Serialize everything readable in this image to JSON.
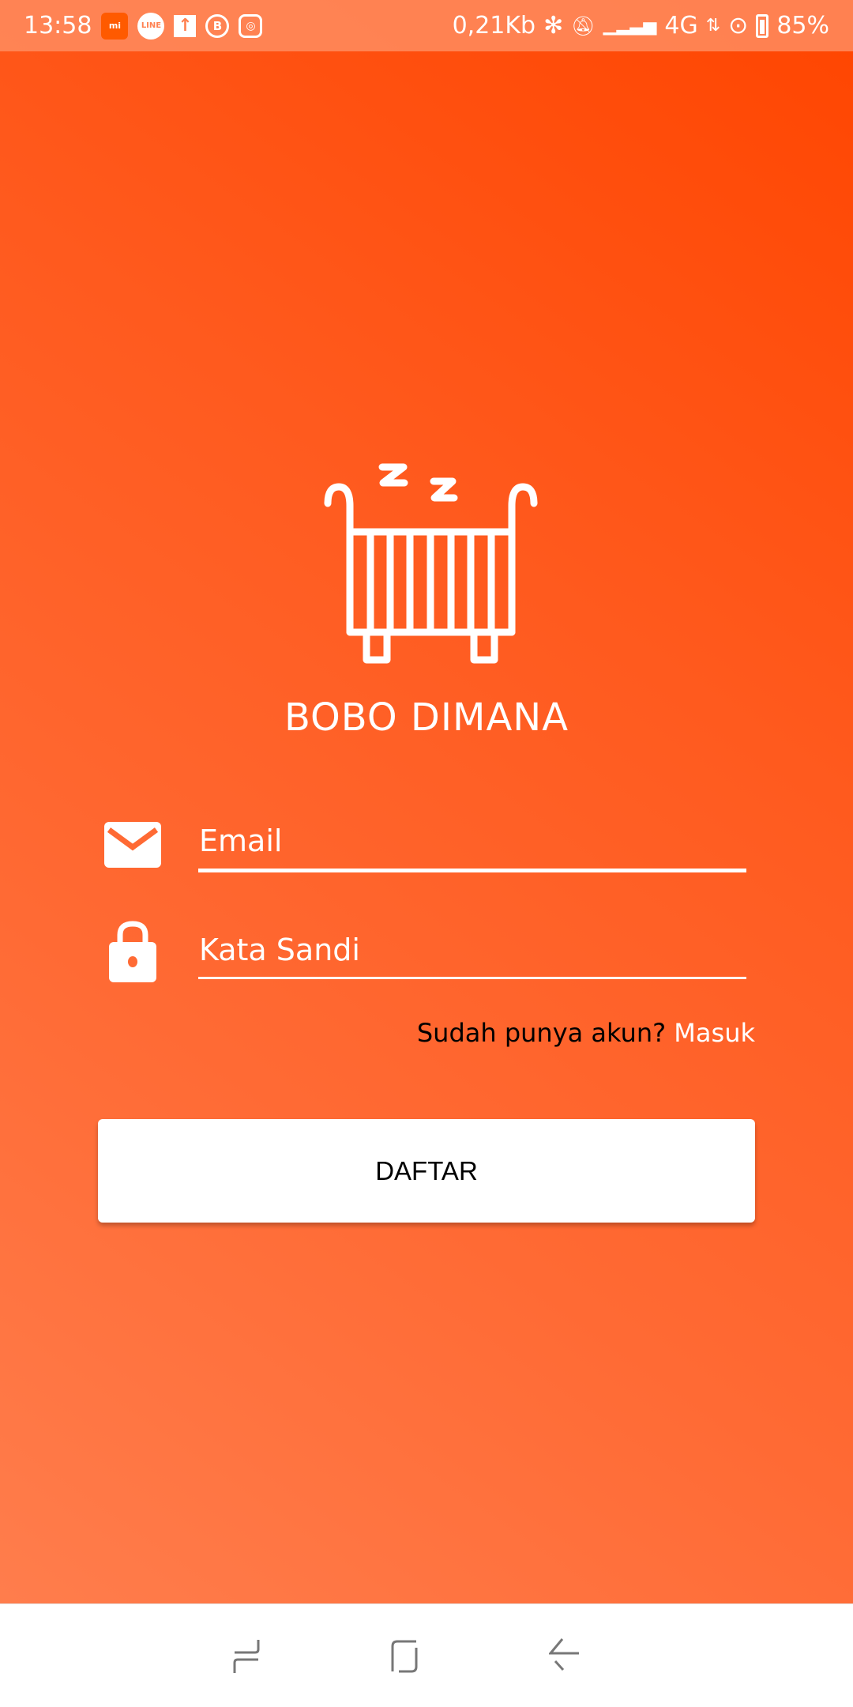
{
  "status_bar": {
    "time": "13:58",
    "notification_icons": [
      "mi-icon",
      "line-icon",
      "upload-icon",
      "whatsapp-business-icon",
      "instagram-icon"
    ],
    "line_label": "LINE",
    "net_speed": "0,21Kb",
    "network": "4G",
    "battery": "85%"
  },
  "app": {
    "title": "BOBO DIMANA",
    "email_placeholder": "Email",
    "password_placeholder": "Kata Sandi",
    "have_account": "Sudah punya akun?",
    "login_link": "Masuk",
    "register_button": "DAFTAR"
  },
  "colors": {
    "gradient_top": "#ff4500",
    "gradient_bottom": "#ff8050",
    "accent": "#ffffff"
  }
}
